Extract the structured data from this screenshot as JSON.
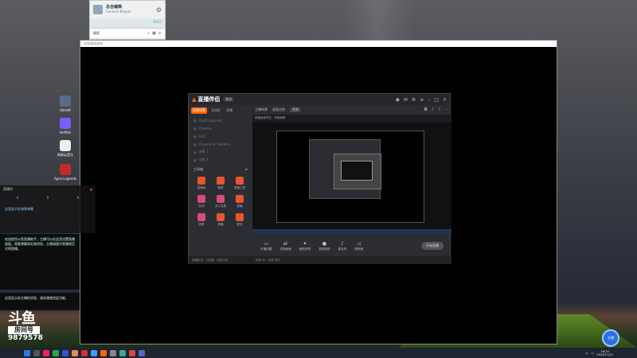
{
  "popup": {
    "name": "总合编辑",
    "sub": "Connect Keeper",
    "badge": "0037",
    "search": "搜索"
  },
  "remote": {
    "title": "远程桌面连接"
  },
  "app": {
    "logo_text": "直播伴侣",
    "version": "版本",
    "tabs": [
      "直播场景",
      "无线投",
      "直播"
    ],
    "sources": [
      "Xsplit Legends",
      "Chrome",
      "Edit",
      "Chrome for MedPlus",
      "场景 1",
      "场景 2"
    ],
    "tools_title": "工具箱",
    "tools": [
      "直播间",
      "截屏",
      "直播工具",
      "互动",
      "多人连麦",
      "直播",
      "投屏",
      "直播",
      "更多"
    ],
    "sub_tabs": [
      "主播场景",
      "画面比例",
      "视频"
    ],
    "preview_bar": "直播画面预览 · 场景编辑",
    "controls": [
      "开播设置",
      "切换画面",
      "美颜滤镜",
      "录制视频",
      "麦克风",
      "扬声器"
    ],
    "go_live": "开始直播",
    "status_left": "直播状态：已连接 · 网络正常",
    "status_right": "帧率 60 · 码率 良好"
  },
  "left_panel": {
    "title": "直播间",
    "stats": [
      "0",
      "0",
      "0"
    ],
    "line1": "这里显示礼物和弹幕",
    "notice": "欢迎使用斗鱼直播助手，主播可以在这里设置直播画面，观看弹幕和礼物消息，主播请遵守直播规范文明直播。",
    "tip": "这里显示给主播的消息，请合理使用此功能。"
  },
  "douyu": {
    "logo": "斗鱼",
    "room_label": "房间号",
    "room_no": "9879578"
  },
  "desktop_icons": [
    "Ubisoft",
    "VerMini",
    "网易云音乐",
    "Apex Legends"
  ],
  "fab": "主播",
  "taskbar": {
    "time": "16:24",
    "date": "2023/11/21"
  }
}
